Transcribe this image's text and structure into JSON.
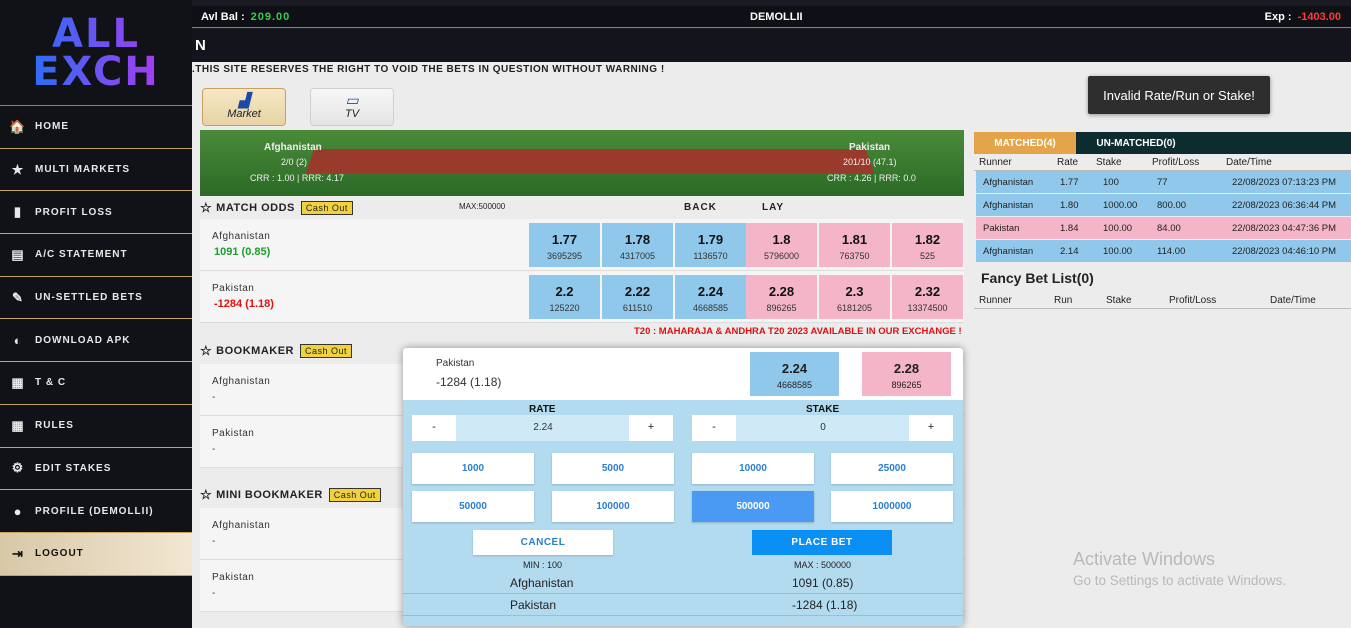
{
  "logo": {
    "line1": "ALL",
    "line2": "EXCH"
  },
  "sidebar": {
    "items": [
      {
        "label": "HOME",
        "icon": "🏠"
      },
      {
        "label": "MULTI MARKETS",
        "icon": "★"
      },
      {
        "label": "PROFIT LOSS",
        "icon": "▮"
      },
      {
        "label": "A/C STATEMENT",
        "icon": "▤"
      },
      {
        "label": "UN-SETTLED BETS",
        "icon": "✎"
      },
      {
        "label": "DOWNLOAD APK",
        "icon": "◐"
      },
      {
        "label": "T & C",
        "icon": "▦"
      },
      {
        "label": "RULES",
        "icon": "▦"
      },
      {
        "label": "EDIT STAKES",
        "icon": "⚙"
      },
      {
        "label": "PROFILE (DEMOLLII)",
        "icon": "●"
      },
      {
        "label": "LOGOUT",
        "icon": "⇥"
      }
    ]
  },
  "topbar": {
    "bal_label": "Avl Bal :",
    "bal_value": "209.00",
    "username": "DEMOLLII",
    "exp_label": "Exp :",
    "exp_value": "-1403.00"
  },
  "headline": "N",
  "marquee": ".THIS SITE RESERVES THE RIGHT TO VOID THE BETS IN QUESTION WITHOUT WARNING !",
  "tabs": {
    "market": "Market",
    "tv": "TV"
  },
  "scoreboard": {
    "team1": "Afghanistan",
    "team1_score": "2/0 (2)",
    "team1_rr": "CRR : 1.00 | RRR: 4.17",
    "team2": "Pakistan",
    "team2_score": "201/10 (47.1)",
    "team2_rr": "CRR : 4.26 | RRR: 0.0"
  },
  "match_odds": {
    "title": "MATCH ODDS",
    "cashout": "Cash Out",
    "max": "MAX:500000",
    "back_label": "BACK",
    "lay_label": "LAY",
    "runners": [
      {
        "name": "Afghanistan",
        "pl": "1091 (0.85)",
        "odds": [
          [
            "1.77",
            "3695295"
          ],
          [
            "1.78",
            "4317005"
          ],
          [
            "1.79",
            "1136570"
          ],
          [
            "1.8",
            "5796000"
          ],
          [
            "1.81",
            "763750"
          ],
          [
            "1.82",
            "525"
          ]
        ]
      },
      {
        "name": "Pakistan",
        "pl": "-1284 (1.18)",
        "odds": [
          [
            "2.2",
            "125220"
          ],
          [
            "2.22",
            "611510"
          ],
          [
            "2.24",
            "4668585"
          ],
          [
            "2.28",
            "896265"
          ],
          [
            "2.3",
            "6181205"
          ],
          [
            "2.32",
            "13374500"
          ]
        ]
      }
    ]
  },
  "notice": "T20 : MAHARAJA & ANDHRA T20 2023 AVAILABLE IN OUR EXCHANGE !",
  "bookmaker": {
    "title": "BOOKMAKER",
    "cashout": "Cash Out",
    "runners": [
      {
        "name": "Afghanistan",
        "pl": "-"
      },
      {
        "name": "Pakistan",
        "pl": "-"
      }
    ]
  },
  "mini_bookmaker": {
    "title": "MINI BOOKMAKER",
    "cashout": "Cash Out",
    "runners": [
      {
        "name": "Afghanistan",
        "pl": "-"
      },
      {
        "name": "Pakistan",
        "pl": "-"
      }
    ]
  },
  "right_panel": {
    "matched_tab": "MATCHED(4)",
    "unmatched_tab": "UN-MATCHED(0)",
    "headers": [
      "Runner",
      "Rate",
      "Stake",
      "Profit/Loss",
      "Date/Time"
    ],
    "bets": [
      {
        "runner": "Afghanistan",
        "rate": "1.77",
        "stake": "100",
        "pl": "77",
        "time": "22/08/2023 07:13:23 PM",
        "side": "back"
      },
      {
        "runner": "Afghanistan",
        "rate": "1.80",
        "stake": "1000.00",
        "pl": "800.00",
        "time": "22/08/2023 06:36:44 PM",
        "side": "back"
      },
      {
        "runner": "Pakistan",
        "rate": "1.84",
        "stake": "100.00",
        "pl": "84.00",
        "time": "22/08/2023 04:47:36 PM",
        "side": "lay"
      },
      {
        "runner": "Afghanistan",
        "rate": "2.14",
        "stake": "100.00",
        "pl": "114.00",
        "time": "22/08/2023 04:46:10 PM",
        "side": "back"
      }
    ],
    "fancy_title": "Fancy Bet List(0)",
    "fancy_headers": [
      "Runner",
      "Run",
      "Stake",
      "Profit/Loss",
      "Date/Time"
    ]
  },
  "toast": "Invalid Rate/Run or Stake!",
  "betslip": {
    "team": "Pakistan",
    "pl": "-1284 (1.18)",
    "back_price": "2.24",
    "back_size": "4668585",
    "lay_price": "2.28",
    "lay_size": "896265",
    "rate_label": "RATE",
    "stake_label": "STAKE",
    "minus": "-",
    "plus": "+",
    "rate_value": "2.24",
    "stake_value": "0",
    "chips": [
      "1000",
      "5000",
      "10000",
      "25000",
      "50000",
      "100000",
      "500000",
      "1000000"
    ],
    "selected_chip": "500000",
    "cancel_label": "CANCEL",
    "place_label": "PLACE BET",
    "min_text": "MIN : 100",
    "max_text": "MAX : 500000",
    "summary": [
      {
        "team": "Afghanistan",
        "pl": "1091 (0.85)"
      },
      {
        "team": "Pakistan",
        "pl": "-1284 (1.18)"
      }
    ]
  },
  "watermark": {
    "line1": "Activate Windows",
    "line2": "Go to Settings to activate Windows."
  },
  "colors": {
    "back": "#8fc8ea",
    "lay": "#f4b5c8",
    "accent": "#e4a44a",
    "place": "#0a8ff5"
  }
}
